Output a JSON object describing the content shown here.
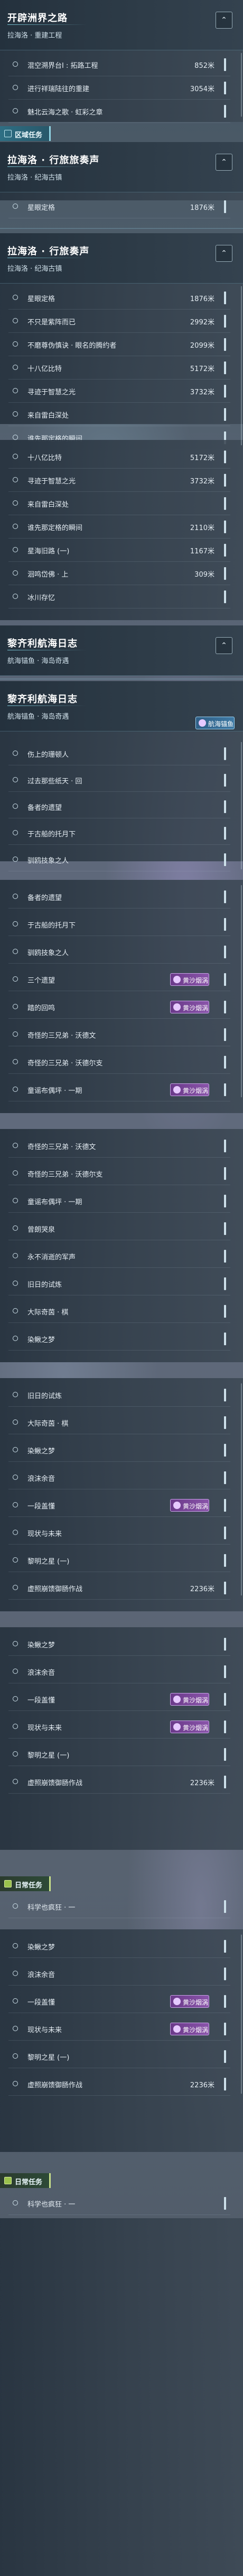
{
  "sections": [
    {
      "title": "开辟洲界之路",
      "subtitle": "拉海洛 · 重建工程",
      "rows": [
        {
          "label": "混空溯界台Ⅰ : 拓路工程",
          "value": "852米"
        },
        {
          "label": "进行祥瑞陆往的重建",
          "value": "3054米"
        },
        {
          "label": "魅北云海之歌 · 虹彩之章",
          "value": ""
        }
      ]
    },
    {
      "tag": "区域任务",
      "title": "拉海洛 · 行旅旅奏声",
      "subtitle": "拉海洛 · 纪海古镇",
      "rows": [
        {
          "label": "星眼定格",
          "value": "1876米"
        }
      ]
    },
    {
      "title": "拉海洛 · 行旅奏声",
      "subtitle": "拉海洛 · 纪海古镇",
      "rows": [
        {
          "label": "星眼定格",
          "value": "1876米"
        },
        {
          "label": "不只是紫阵而已",
          "value": "2992米"
        },
        {
          "label": "不磨尊伪慎诀 · 眼名的腾约者",
          "value": "2099米"
        },
        {
          "label": "十八亿比特",
          "value": "5172米"
        },
        {
          "label": "寻迹于智慧之光",
          "value": "3732米"
        },
        {
          "label": "来自雷白深处",
          "value": ""
        },
        {
          "label": "谁先那定格的瞬间",
          "value": ""
        }
      ]
    },
    {
      "title": "",
      "subtitle": "",
      "rows": [
        {
          "label": "十八亿比特",
          "value": "5172米"
        },
        {
          "label": "寻迹于智慧之光",
          "value": "3732米"
        },
        {
          "label": "来自雷白深处",
          "value": ""
        },
        {
          "label": "谁先那定格的瞬间",
          "value": "2110米"
        },
        {
          "label": "星海旧路 (一)",
          "value": "1167米"
        },
        {
          "label": "洄鸣岱佛 · 上",
          "value": "309米"
        },
        {
          "label": "冰川存忆",
          "value": ""
        }
      ]
    },
    {
      "title": "黎齐利航海日志",
      "subtitle": "航海锚鱼 · 海岛奇遇",
      "rows": []
    },
    {
      "title": "黎齐利航海日志",
      "subtitle": "航海锚鱼 · 海岛奇遇",
      "badge": "航海锚鱼",
      "rows": [
        {
          "label": "伤上的珊顿人",
          "value": ""
        },
        {
          "label": "过去那些纸天 · 回",
          "value": ""
        },
        {
          "label": "备者的遗望",
          "value": ""
        },
        {
          "label": "于古船的托月下",
          "value": ""
        },
        {
          "label": "驯鸥技象之人",
          "value": ""
        }
      ]
    }
  ],
  "list_a": [
    {
      "label": "备者的遗望",
      "badge": ""
    },
    {
      "label": "于古船的托月下",
      "badge": ""
    },
    {
      "label": "驯鸥技象之人",
      "badge": ""
    },
    {
      "label": "三个遗望",
      "badge": "黄沙烟涡"
    },
    {
      "label": "踏的回鸣",
      "badge": "黄沙烟涡"
    },
    {
      "label": "奇怪的三兄弟 · 沃德文",
      "badge": ""
    },
    {
      "label": "奇怪的三兄弟 · 沃德尔支",
      "badge": ""
    },
    {
      "label": "童谣布偶坪 · 一期",
      "badge": "黄沙烟涡"
    }
  ],
  "list_b": [
    {
      "label": "奇怪的三兄弟 · 沃德文",
      "badge": ""
    },
    {
      "label": "奇怪的三兄弟 · 沃德尔支",
      "badge": ""
    },
    {
      "label": "童谣布偶坪 · 一期",
      "badge": ""
    },
    {
      "label": "曾朗哭泉",
      "badge": ""
    },
    {
      "label": "永不消逝的军声",
      "badge": ""
    },
    {
      "label": "旧日的试炼",
      "badge": ""
    },
    {
      "label": "大际奇茵 · 棋",
      "badge": ""
    },
    {
      "label": "染鳅之梦",
      "badge": ""
    }
  ],
  "list_c": [
    {
      "label": "旧日的试炼",
      "value": ""
    },
    {
      "label": "大际奇茵 · 棋",
      "value": ""
    },
    {
      "label": "染鳅之梦",
      "value": ""
    },
    {
      "label": "浪沫余音",
      "value": ""
    },
    {
      "label": "一段盖懂",
      "value": "",
      "badge": "黄沙烟涡"
    },
    {
      "label": "现状与未来",
      "value": ""
    },
    {
      "label": "黎明之星 (一)",
      "value": ""
    },
    {
      "label": "虚照崩馈御肠作战",
      "value": "2236米"
    }
  ],
  "list_d": [
    {
      "label": "染鳅之梦",
      "value": ""
    },
    {
      "label": "浪沫余音",
      "value": ""
    },
    {
      "label": "一段盖懂",
      "value": "",
      "badge": "黄沙烟涡"
    },
    {
      "label": "现状与未来",
      "value": "",
      "badge": "黄沙烟涡"
    },
    {
      "label": "黎明之星 (一)",
      "value": ""
    },
    {
      "label": "虚照崩馈御肠作战",
      "value": "2236米"
    }
  ],
  "daily_tag": "日常任务",
  "daily_row": "科学也疯狂 · 一",
  "list_e": [
    {
      "label": "染鳅之梦",
      "value": ""
    },
    {
      "label": "浪沫余音",
      "value": ""
    },
    {
      "label": "一段盖懂",
      "value": "",
      "badge": "黄沙烟涡"
    },
    {
      "label": "现状与未来",
      "value": "",
      "badge": "黄沙烟涡"
    },
    {
      "label": "黎明之星 (一)",
      "value": ""
    },
    {
      "label": "虚照崩馈御肠作战",
      "value": "2236米"
    }
  ],
  "collapse_glyph": "⌃"
}
